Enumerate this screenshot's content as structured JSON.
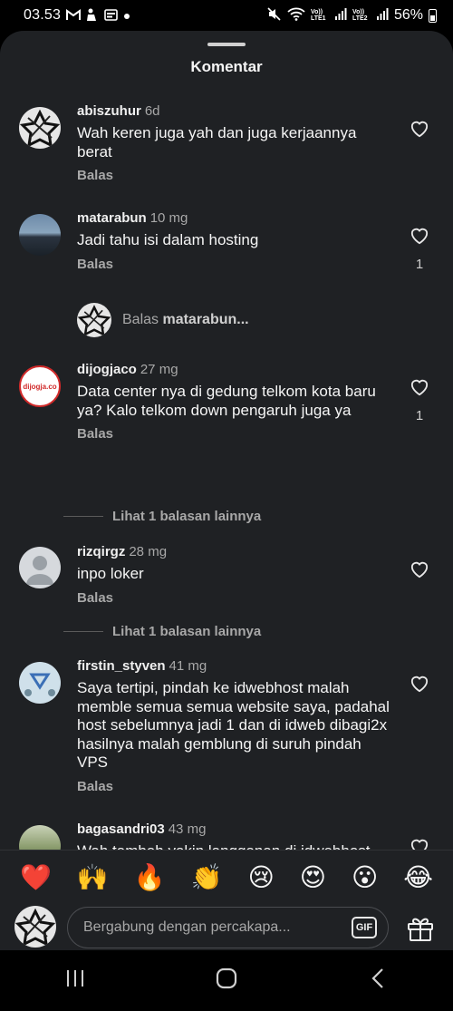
{
  "status_bar": {
    "time": "03.53",
    "icons_left": [
      "gmail-icon",
      "shopee-icon",
      "notification-icon",
      "dot-icon"
    ],
    "icons_right": [
      "mute-icon",
      "wifi-icon",
      "volte1-icon",
      "signal1-icon",
      "volte2-icon",
      "signal2-icon"
    ],
    "volte1": "Vo)) LTE1",
    "volte2": "Vo)) LTE2",
    "battery": "56%"
  },
  "sheet": {
    "title": "Komentar"
  },
  "comments": [
    {
      "user": "abiszuhur",
      "time": "6d",
      "text": "Wah keren juga yah dan juga kerjaannya berat",
      "reply": "Balas",
      "likes": ""
    },
    {
      "user": "matarabun",
      "time": "10 mg",
      "text": "Jadi tahu isi dalam hosting",
      "reply": "Balas",
      "likes": "1"
    },
    {
      "user": "dijogjaco",
      "time": "27 mg",
      "text": "Data center nya di gedung telkom kota baru ya? Kalo telkom down pengaruh juga ya",
      "reply": "Balas",
      "likes": "1",
      "avatar_text": "dijogja.co"
    },
    {
      "user": "rizqirgz",
      "time": "28 mg",
      "text": "inpo loker",
      "reply": "Balas",
      "likes": ""
    },
    {
      "user": "firstin_styven",
      "time": "41 mg",
      "text": "Saya tertipi, pindah ke idwebhost malah memble semua semua website saya, padahal host sebelumnya jadi 1 dan di idweb dibagi2x hasilnya malah gemblung di suruh pindah VPS",
      "reply": "Balas",
      "likes": ""
    },
    {
      "user": "bagasandri03",
      "time": "43 mg",
      "text": "Wah  tambah yakin langganan di idwebhost, server aja di jagain apalagi",
      "reply": "",
      "likes": ""
    }
  ],
  "reply_prompt": {
    "prefix": "Balas ",
    "user": "matarabun..."
  },
  "more_replies": [
    "Lihat 1 balasan lainnya",
    "Lihat 1 balasan lainnya"
  ],
  "emoji_bar": [
    "❤️",
    "🙌",
    "🔥",
    "👏",
    "😢",
    "😍",
    "😮",
    "😂"
  ],
  "input": {
    "placeholder": "Bergabung dengan percakapa...",
    "gif_label": "GIF"
  },
  "colors": {
    "sheet_bg": "#1f2124",
    "accent": "#ffffff",
    "muted": "#a8a8a8"
  }
}
